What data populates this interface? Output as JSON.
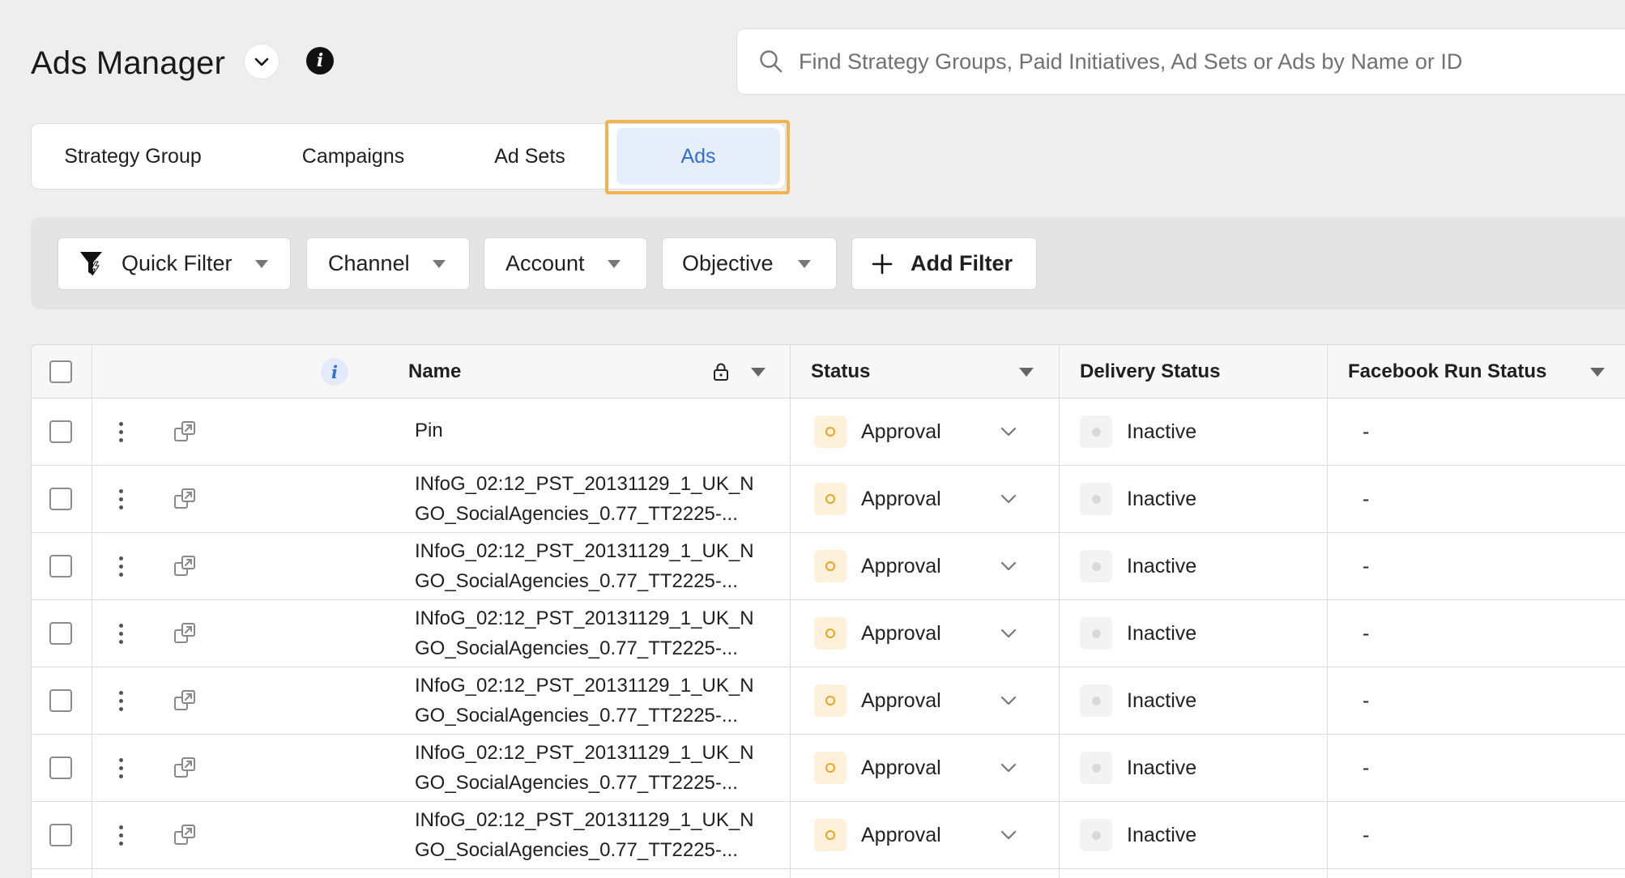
{
  "header": {
    "title": "Ads Manager",
    "search_placeholder": "Find Strategy Groups, Paid Initiatives, Ad Sets or Ads by Name or ID"
  },
  "tabs": [
    {
      "label": "Strategy Group"
    },
    {
      "label": "Campaigns"
    },
    {
      "label": "Ad Sets"
    },
    {
      "label": "Ads",
      "active": true
    }
  ],
  "filters": {
    "quick_filter": "Quick Filter",
    "channel": "Channel",
    "account": "Account",
    "objective": "Objective",
    "add_filter": "Add Filter"
  },
  "table": {
    "columns": {
      "name": "Name",
      "status": "Status",
      "delivery_status": "Delivery Status",
      "facebook_run_status": "Facebook Run Status"
    },
    "rows": [
      {
        "name_line1": "Pin",
        "name_line2": "",
        "status": "Approval",
        "delivery": "Inactive",
        "fb_run": "-"
      },
      {
        "name_line1": "INfoG_02:12_PST_20131129_1_UK_N",
        "name_line2": "GO_SocialAgencies_0.77_TT2225-...",
        "status": "Approval",
        "delivery": "Inactive",
        "fb_run": "-"
      },
      {
        "name_line1": "INfoG_02:12_PST_20131129_1_UK_N",
        "name_line2": "GO_SocialAgencies_0.77_TT2225-...",
        "status": "Approval",
        "delivery": "Inactive",
        "fb_run": "-"
      },
      {
        "name_line1": "INfoG_02:12_PST_20131129_1_UK_N",
        "name_line2": "GO_SocialAgencies_0.77_TT2225-...",
        "status": "Approval",
        "delivery": "Inactive",
        "fb_run": "-"
      },
      {
        "name_line1": "INfoG_02:12_PST_20131129_1_UK_N",
        "name_line2": "GO_SocialAgencies_0.77_TT2225-...",
        "status": "Approval",
        "delivery": "Inactive",
        "fb_run": "-"
      },
      {
        "name_line1": "INfoG_02:12_PST_20131129_1_UK_N",
        "name_line2": "GO_SocialAgencies_0.77_TT2225-...",
        "status": "Approval",
        "delivery": "Inactive",
        "fb_run": "-"
      },
      {
        "name_line1": "INfoG_02:12_PST_20131129_1_UK_N",
        "name_line2": "GO_SocialAgencies_0.77_TT2225-...",
        "status": "Approval",
        "delivery": "Inactive",
        "fb_run": "-"
      }
    ]
  },
  "colors": {
    "accent": "#2f6fd6",
    "highlight_frame": "#f2b44f",
    "approval": "#f0a420"
  },
  "icons": {
    "title_dropdown": "chevron-down-icon",
    "info": "info-icon",
    "search": "search-icon",
    "quick_filter": "funnel-bolt-icon",
    "add_filter": "plus-icon",
    "row_menu": "kebab-icon",
    "row_open": "open-external-icon",
    "lock": "lock-icon"
  }
}
